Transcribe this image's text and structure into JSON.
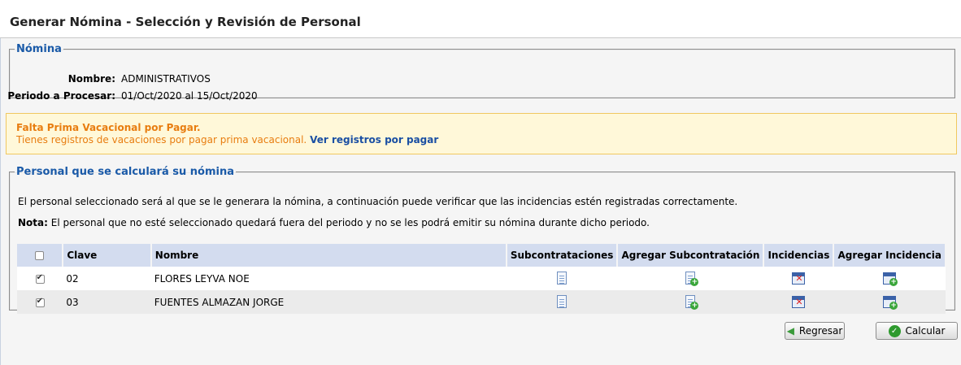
{
  "page": {
    "title": "Generar Nómina - Selección y Revisión de Personal"
  },
  "nomina": {
    "legend": "Nómina",
    "nombre_label": "Nombre:",
    "nombre_value": "ADMINISTRATIVOS",
    "periodo_label": "Periodo a Procesar:",
    "periodo_value": "01/Oct/2020 al 15/Oct/2020"
  },
  "alert": {
    "title": "Falta Prima Vacacional por Pagar.",
    "message": "Tienes registros de vacaciones por pagar prima vacacional.",
    "link": "Ver registros por pagar"
  },
  "personal": {
    "legend": "Personal que se calculará su nómina",
    "description": "El personal seleccionado será al que se le generara la nómina, a continuación puede verificar que las incidencias estén registradas correctamente.",
    "note_label": "Nota:",
    "note_text": " El personal que no esté seleccionado quedará fuera del periodo y no se les podrá emitir su nómina durante dicho periodo.",
    "columns": [
      "Clave",
      "Nombre",
      "Subcontrataciones",
      "Agregar Subcontratación",
      "Incidencias",
      "Agregar Incidencia"
    ],
    "rows": [
      {
        "checked": true,
        "clave": "02",
        "nombre": "FLORES LEYVA NOE"
      },
      {
        "checked": true,
        "clave": "03",
        "nombre": "FUENTES ALMAZAN JORGE"
      }
    ]
  },
  "buttons": {
    "regresar": "Regresar",
    "calcular": "Calcular"
  },
  "icons": {
    "subcontrataciones": "document-icon",
    "agregar_subcontratacion": "document-add-icon",
    "incidencias": "calendar-delete-icon",
    "agregar_incidencia": "calendar-add-icon",
    "regresar": "back-arrow-icon",
    "calcular": "check-circle-icon"
  },
  "colors": {
    "accent": "#1a5aa8",
    "warning": "#e87d10",
    "header_row": "#d3dcef"
  }
}
